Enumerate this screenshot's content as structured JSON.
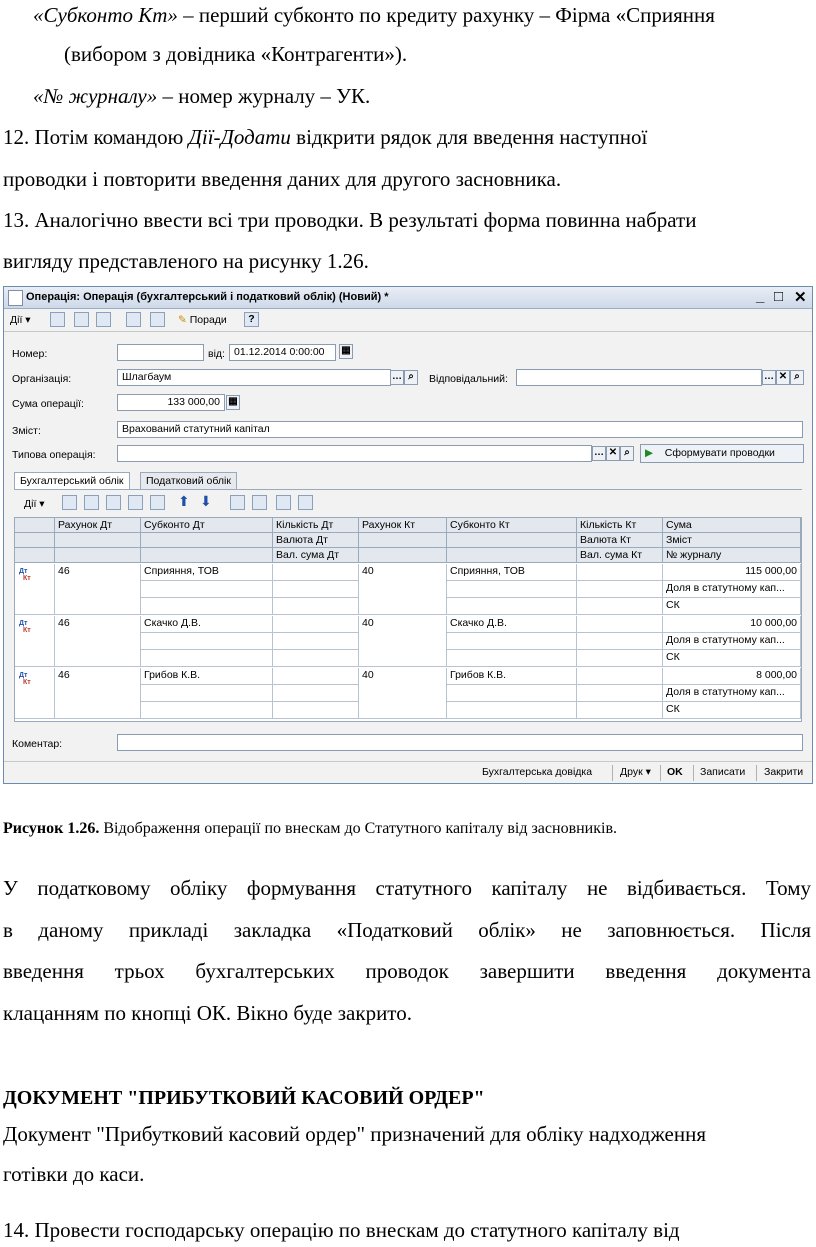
{
  "text": {
    "line1_a": "«Субконто Кт»",
    "line1_b": " – перший субконто по кредиту рахунку – Фірма «Сприяння",
    "line2": "(вибором з довідника «Контрагенти»).",
    "line3_a": "«№ журналу»",
    "line3_b": " – номер журналу – УК.",
    "line4_a": "12. Потім командою ",
    "line4_b": "Дії-Додати",
    "line4_c": " відкрити рядок для введення наступної",
    "line5": "проводки і повторити введення даних для другого засновника.",
    "line6": "13. Аналогічно ввести всі три проводки. В результаті форма повинна набрати",
    "line7": "вигляду представленого на рисунку 1.26.",
    "caption_bold": "Рисунок 1.26.",
    "caption_rest": " Відображення операції по внескам до Статутного капіталу від засновників.",
    "p1": "У податковому обліку формування статутного капіталу не відбивається. Тому",
    "p2": "в даному прикладі закладка «Податковий облік» не заповнюється. Після",
    "p3": "введення трьох бухгалтерських проводок завершити введення документа",
    "p4": "клацанням по кнопці ОК. Вікно буде закрито.",
    "heading": "ДОКУМЕНТ \"ПРИБУТКОВИЙ КАСОВИЙ ОРДЕР\"",
    "p5": "Документ \"Прибутковий касовий ордер\" призначений для обліку надходження",
    "p6": "готівки до каси.",
    "p7": "14. Провести господарську операцію по внескам до статутного капіталу від"
  },
  "window": {
    "title": "Операція: Операція (бухгалтерський і податковий облік) (Новий) *",
    "controls": [
      "_",
      "□",
      "✕"
    ],
    "toolbar": {
      "actions": "Дії",
      "hints": "Поради"
    },
    "fields": {
      "number_label": "Номер:",
      "number_value": "",
      "date_label": "від:",
      "date_value": "01.12.2014  0:00:00",
      "org_label": "Організація:",
      "org_value": "Шлагбаум",
      "resp_label": "Відповідальний:",
      "resp_value": "",
      "sum_label": "Сума операції:",
      "sum_value": "133 000,00",
      "content_label": "Зміст:",
      "content_value": "Врахований статутний капітал",
      "type_label": "Типова операція:",
      "type_value": "",
      "generate_button": "Сформувати проводки",
      "comment_label": "Коментар:",
      "comment_value": ""
    },
    "tabs": [
      "Бухгалтерський облік",
      "Податковий облік"
    ],
    "grid_toolbar": {
      "actions": "Дії"
    },
    "grid": {
      "headers": [
        [
          "",
          "Рахунок Дт",
          "Субконто Дт",
          "Кількість Дт",
          "Рахунок Кт",
          "Субконто Кт",
          "Кількість Кт",
          "Сума"
        ],
        [
          "",
          "",
          "",
          "Валюта Дт",
          "",
          "",
          "Валюта Кт",
          "Зміст"
        ],
        [
          "",
          "",
          "",
          "Вал. сума Дт",
          "",
          "",
          "Вал. сума Кт",
          "№ журналу"
        ]
      ],
      "rows": [
        {
          "icon": "ДтКт",
          "debit": "46",
          "sub_dt": "Сприяння, ТОВ",
          "credit": "40",
          "sub_kt": "Сприяння, ТОВ",
          "sum": "115 000,00",
          "content": "Доля в статутному кап...",
          "journal": "СК"
        },
        {
          "icon": "ДтКт",
          "debit": "46",
          "sub_dt": "Скачко Д.В.",
          "credit": "40",
          "sub_kt": "Скачко Д.В.",
          "sum": "10 000,00",
          "content": "Доля в статутному кап...",
          "journal": "СК"
        },
        {
          "icon": "ДтКт",
          "debit": "46",
          "sub_dt": "Грибов К.В.",
          "credit": "40",
          "sub_kt": "Грибов К.В.",
          "sum": "8 000,00",
          "content": "Доля в статутному кап...",
          "journal": "СК"
        }
      ]
    },
    "status": {
      "reference": "Бухгалтерська довідка",
      "print": "Друк",
      "ok": "OK",
      "save": "Записати",
      "close": "Закрити"
    }
  }
}
